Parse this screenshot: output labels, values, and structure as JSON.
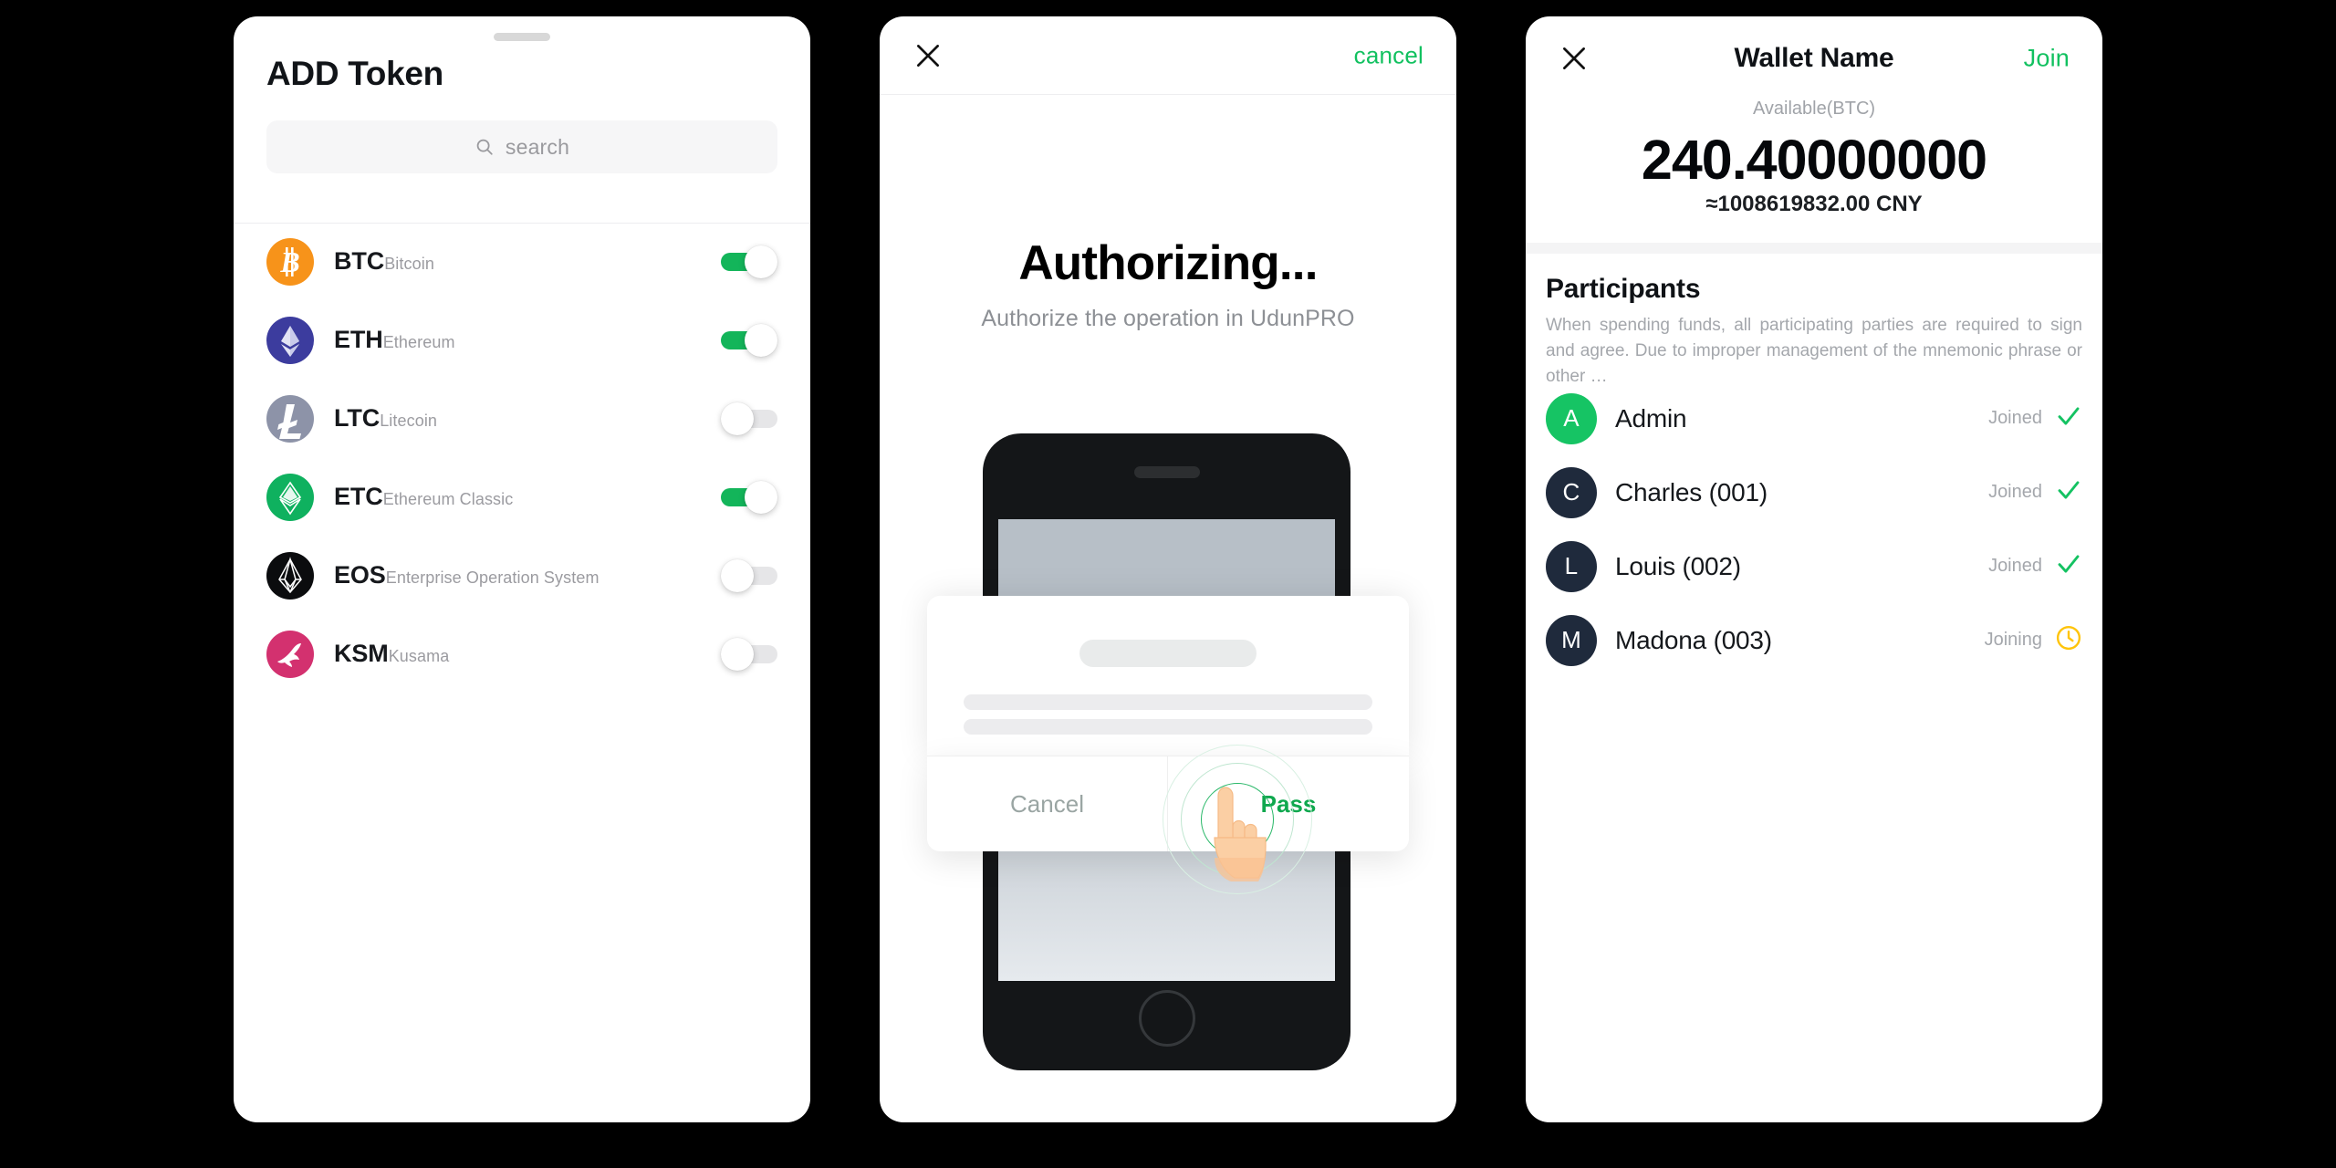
{
  "panels": {
    "add_token": {
      "title": "ADD Token",
      "search": {
        "placeholder": "search",
        "icon": "search-icon"
      },
      "tokens": [
        {
          "symbol": "BTC",
          "name": "Bitcoin",
          "enabled": true,
          "icon": "bitcoin-icon",
          "color": "#f7931a"
        },
        {
          "symbol": "ETH",
          "name": "Ethereum",
          "enabled": true,
          "icon": "ethereum-icon",
          "color": "#3c3c9e"
        },
        {
          "symbol": "LTC",
          "name": "Litecoin",
          "enabled": false,
          "icon": "litecoin-icon",
          "color": "#8d93a8"
        },
        {
          "symbol": "ETC",
          "name": "Ethereum Classic",
          "enabled": true,
          "icon": "ethereum-classic-icon",
          "color": "#0fb15f"
        },
        {
          "symbol": "EOS",
          "name": "Enterprise Operation System",
          "enabled": false,
          "icon": "eos-icon",
          "color": "#0b0c0e"
        },
        {
          "symbol": "KSM",
          "name": "Kusama",
          "enabled": false,
          "icon": "kusama-icon",
          "color": "#d3316f"
        }
      ]
    },
    "authorizing": {
      "close_icon": "close-icon",
      "cancel_label": "cancel",
      "title": "Authorizing...",
      "subtitle": "Authorize the operation in UdunPRO",
      "dialog": {
        "cancel_label": "Cancel",
        "pass_label": "Pass",
        "tap_icon": "pointing-hand-icon"
      }
    },
    "wallet": {
      "close_icon": "close-icon",
      "title": "Wallet Name",
      "join_label": "Join",
      "available_label": "Available(BTC)",
      "balance": "240.40000000",
      "balance_fiat": "≈1008619832.00 CNY",
      "participants_title": "Participants",
      "participants_desc": "When spending funds, all participating parties are required to sign and agree. Due to improper management of the mnemonic phrase or other …",
      "participants": [
        {
          "initial": "A",
          "name": "Admin",
          "status": "Joined",
          "state": "joined",
          "avatar_color": "#16c464",
          "status_icon": "check-icon"
        },
        {
          "initial": "C",
          "name": "Charles (001)",
          "status": "Joined",
          "state": "joined",
          "avatar_color": "#1f2a3c",
          "status_icon": "check-icon"
        },
        {
          "initial": "L",
          "name": "Louis (002)",
          "status": "Joined",
          "state": "joined",
          "avatar_color": "#1f2a3c",
          "status_icon": "check-icon"
        },
        {
          "initial": "M",
          "name": "Madona (003)",
          "status": "Joining",
          "state": "joining",
          "avatar_color": "#1f2a3c",
          "status_icon": "clock-icon"
        }
      ]
    }
  },
  "colors": {
    "accent_green": "#12c160",
    "toggle_on": "#13b55a",
    "toggle_off": "#e6e6e8",
    "pending_amber": "#ffc40a",
    "background": "#000000"
  }
}
